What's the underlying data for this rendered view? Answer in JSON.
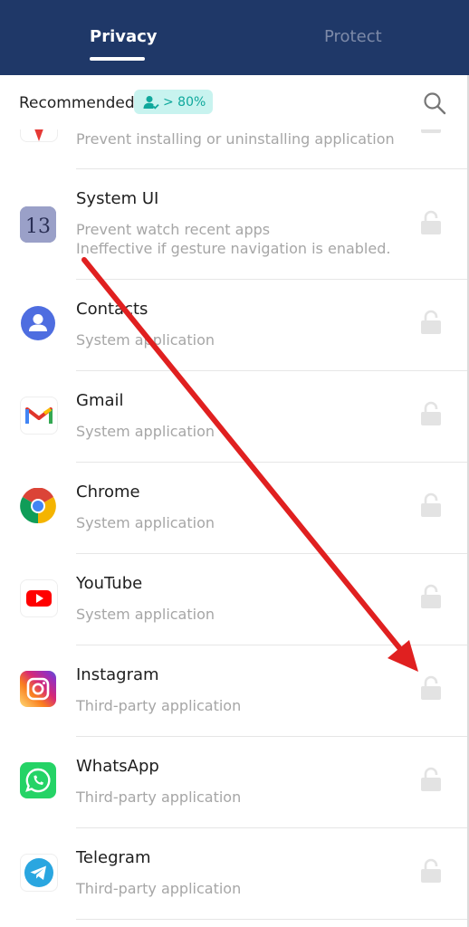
{
  "tabs": {
    "privacy": "Privacy",
    "protect": "Protect"
  },
  "subheader": {
    "recommended": "Recommended",
    "badge": "> 80%"
  },
  "partial_row": {
    "desc": "Prevent installing or uninstalling application"
  },
  "apps": [
    {
      "name": "System UI",
      "desc": "Prevent watch recent apps",
      "desc2": "Ineffective if gesture navigation is enabled.",
      "icon": "system-ui-icon"
    },
    {
      "name": "Contacts",
      "desc": "System application",
      "icon": "contacts-icon"
    },
    {
      "name": "Gmail",
      "desc": "System application",
      "icon": "gmail-icon"
    },
    {
      "name": "Chrome",
      "desc": "System application",
      "icon": "chrome-icon"
    },
    {
      "name": "YouTube",
      "desc": "System application",
      "icon": "youtube-icon"
    },
    {
      "name": "Instagram",
      "desc": "Third-party application",
      "icon": "instagram-icon"
    },
    {
      "name": "WhatsApp",
      "desc": "Third-party application",
      "icon": "whatsapp-icon"
    },
    {
      "name": "Telegram",
      "desc": "Third-party application",
      "icon": "telegram-icon"
    }
  ],
  "colors": {
    "header": "#1f3868",
    "badge_bg": "#c8f3ef",
    "badge_text": "#0fa89c",
    "arrow": "#e02020"
  }
}
